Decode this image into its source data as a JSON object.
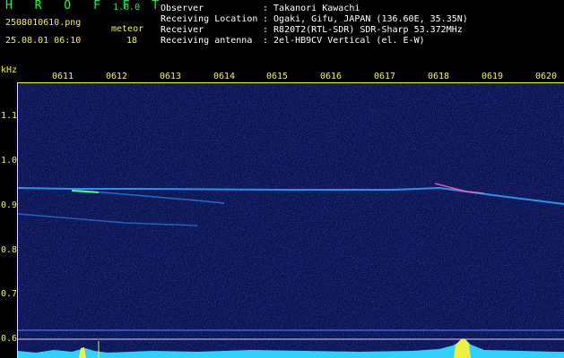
{
  "header": {
    "app_name": "H R O F F T",
    "version": "1.0.0",
    "filename": "2508010610.png",
    "meteor_label": "meteor",
    "datetime": "25.08.01 06:10",
    "meteor_count": "18"
  },
  "info": [
    {
      "key": "Observer",
      "value": ": Takanori Kawachi"
    },
    {
      "key": "Receiving Location",
      "value": ": Ogaki, Gifu, JAPAN (136.60E, 35.35N)"
    },
    {
      "key": "Receiver",
      "value": ": R820T2(RTL-SDR) SDR-Sharp 53.372MHz"
    },
    {
      "key": "Receiving antenna",
      "value": ": 2el-HB9CV Vertical (el. E-W)"
    }
  ],
  "axis": {
    "unit": "kHz",
    "time_ticks": [
      "0611",
      "0612",
      "0613",
      "0614",
      "0615",
      "0616",
      "0617",
      "0618",
      "0619",
      "0620"
    ],
    "freq_ticks": [
      "1.1",
      "1.0",
      "0.9",
      "0.8",
      "0.7",
      "0.6"
    ]
  },
  "colors": {
    "background": "#000000",
    "label": "#f0f040",
    "title": "#22ee44",
    "plot_bg": "#0a1050",
    "trace": "#30d0ff"
  }
}
